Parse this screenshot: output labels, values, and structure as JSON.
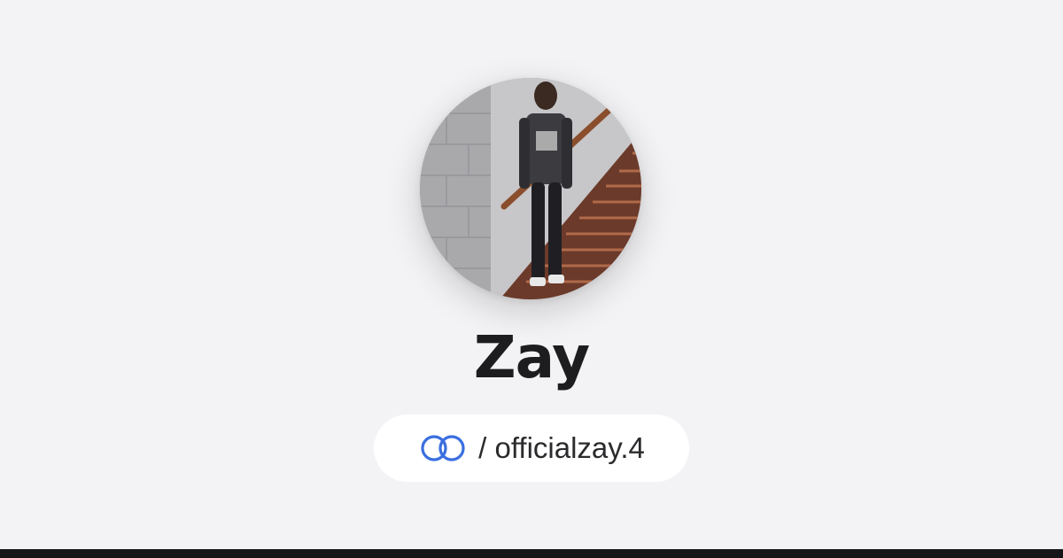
{
  "profile": {
    "display_name": "Zay",
    "handle_separator": "/",
    "handle": "officialzay.4",
    "handle_full": "/ officialzay.4"
  },
  "icons": {
    "link": "linked-rings-icon",
    "avatar": "profile-photo"
  },
  "colors": {
    "background": "#f3f3f5",
    "pill": "#ffffff",
    "text": "#1d1d1f",
    "accent": "#3a6fe0",
    "bottom_bar": "#161618"
  }
}
